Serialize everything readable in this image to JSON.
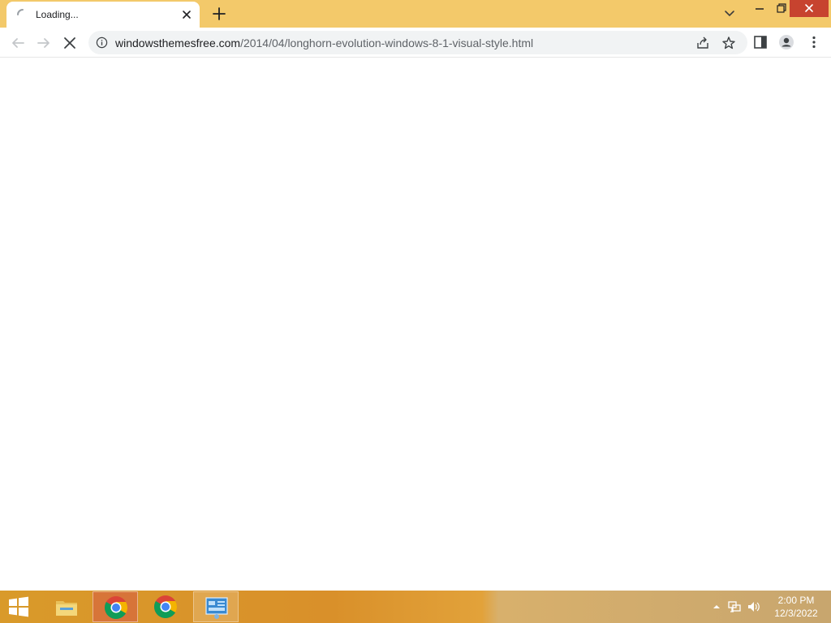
{
  "tab": {
    "title": "Loading..."
  },
  "address_bar": {
    "host": "windowsthemesfree.com",
    "path": "/2014/04/longhorn-evolution-windows-8-1-visual-style.html"
  },
  "taskbar": {
    "apps": [
      "file-explorer",
      "chrome",
      "chrome",
      "control-panel"
    ],
    "clock": {
      "time": "2:00 PM",
      "date": "12/3/2022"
    }
  },
  "colors": {
    "tab_strip": "#f3c96a",
    "close_button": "#c7432f",
    "taskbar": "#d9902a"
  },
  "icons": [
    "loading-spinner-icon",
    "close-icon",
    "plus-icon",
    "chevron-down-icon",
    "minimize-icon",
    "restore-icon",
    "back-arrow-icon",
    "forward-arrow-icon",
    "stop-icon",
    "info-icon",
    "share-icon",
    "star-icon",
    "side-panel-icon",
    "profile-icon",
    "kebab-menu-icon",
    "windows-logo-icon",
    "folder-icon",
    "chrome-icon",
    "control-panel-icon",
    "tray-arrow-icon",
    "network-icon",
    "volume-icon"
  ]
}
